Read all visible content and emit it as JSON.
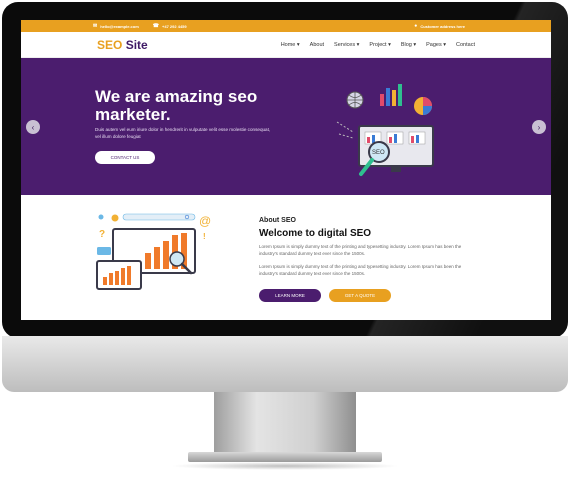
{
  "topbar": {
    "email": "hello@example.com",
    "phone": "+47 292 4459",
    "address": "Customer address here"
  },
  "navbar": {
    "logo_seo": "SEO",
    "logo_site": "Site",
    "items": [
      "Home ▾",
      "About",
      "Services ▾",
      "Project ▾",
      "Blog ▾",
      "Pages ▾",
      "Contact"
    ]
  },
  "hero": {
    "title": "We are amazing seo marketer.",
    "lede": "Duis autem vel eum iriure dolor in hendrerit in vulputate velit esse molestie consequat, vel illum dolore feugiat",
    "cta": "CONTACT US",
    "prev_icon": "‹",
    "next_icon": "›"
  },
  "about": {
    "kicker": "About SEO",
    "title": "Welcome to digital SEO",
    "p1": "Lorem Ipsum is simply dummy text of the printing and typesetting industry. Lorem Ipsum has been the industry's standard dummy text ever since the 1500s.",
    "p2": "Lorem Ipsum is simply dummy text of the printing and typesetting industry. Lorem Ipsum has been the industry's standard dummy text ever since the 1500s.",
    "learn_more": "LEARN MORE",
    "get_quote": "GET A QUOTE"
  },
  "colors": {
    "accent": "#e8a020",
    "brand_purple": "#4b1d6e"
  }
}
